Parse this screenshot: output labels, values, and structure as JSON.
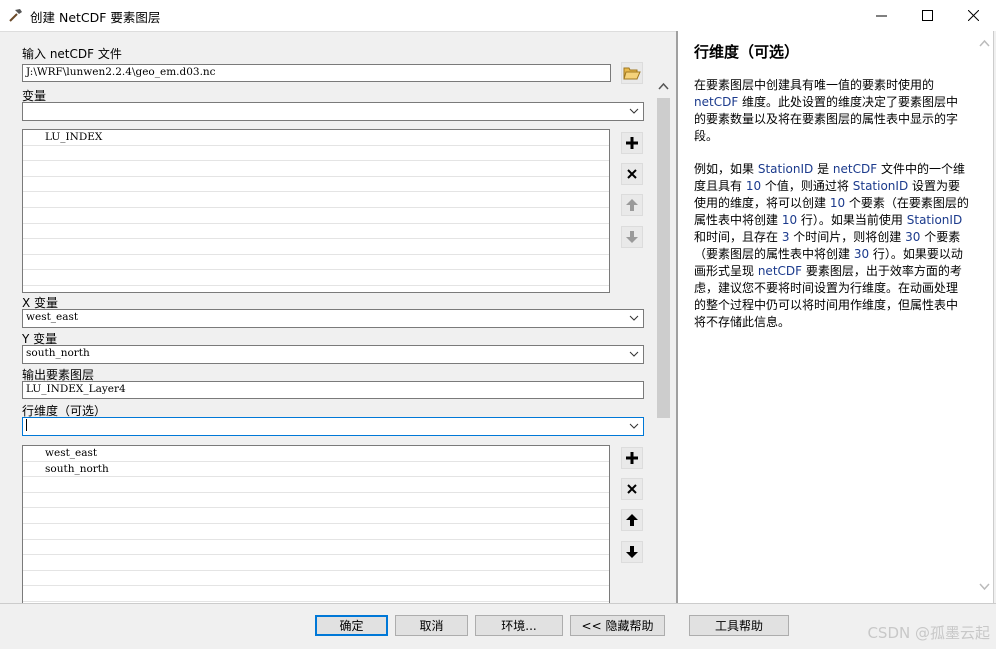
{
  "window": {
    "title": "创建 NetCDF 要素图层"
  },
  "form": {
    "input_file_label": "输入 netCDF 文件",
    "input_file_value": "J:\\WRF\\lunwen2.2.4\\geo_em.d03.nc",
    "variable_label": "变量",
    "variable_value": "",
    "variables_list": [
      "LU_INDEX"
    ],
    "x_label": "X 变量",
    "x_value": "west_east",
    "y_label": "Y 变量",
    "y_value": "south_north",
    "output_label": "输出要素图层",
    "output_value": "LU_INDEX_Layer4",
    "row_dim_label": "行维度（可选）",
    "row_dim_value": "",
    "row_dim_list": [
      "west_east",
      "south_north"
    ]
  },
  "help": {
    "title": "行维度（可选）",
    "para1": [
      {
        "t": "在要素图层中创建具有唯一值的要素时使用的 "
      },
      {
        "t": "netCDF",
        "hl": true
      },
      {
        "t": " 维度。此处设置的维度决定了要素图层中的要素数量以及将在要素图层的属性表中显示的字段。"
      }
    ],
    "para2": [
      {
        "t": "例如，如果 "
      },
      {
        "t": "StationID",
        "hl": true
      },
      {
        "t": " 是 "
      },
      {
        "t": "netCDF",
        "hl": true
      },
      {
        "t": " 文件中的一个维度且具有 "
      },
      {
        "t": "10",
        "hl": true
      },
      {
        "t": " 个值，则通过将 "
      },
      {
        "t": "StationID",
        "hl": true
      },
      {
        "t": " 设置为要使用的维度，将可以创建 "
      },
      {
        "t": "10",
        "hl": true
      },
      {
        "t": " 个要素（在要素图层的属性表中将创建 "
      },
      {
        "t": "10",
        "hl": true
      },
      {
        "t": " 行）。如果当前使用 "
      },
      {
        "t": "StationID",
        "hl": true
      },
      {
        "t": " 和时间，且存在 "
      },
      {
        "t": "3",
        "hl": true
      },
      {
        "t": " 个时间片，则将创建 "
      },
      {
        "t": "30",
        "hl": true
      },
      {
        "t": " 个要素（要素图层的属性表中将创建 "
      },
      {
        "t": "30",
        "hl": true
      },
      {
        "t": " 行）。如果要以动画形式呈现 "
      },
      {
        "t": "netCDF",
        "hl": true
      },
      {
        "t": " 要素图层，出于效率方面的考虑，建议您不要将时间设置为行维度。在动画处理的整个过程中仍可以将时间用作维度，但属性表中将不存储此信息。"
      }
    ]
  },
  "buttons": {
    "ok": "确定",
    "cancel": "取消",
    "env": "环境...",
    "hide_help": "<< 隐藏帮助",
    "tool_help": "工具帮助"
  },
  "watermark": "CSDN @孤墨云起",
  "icons": {
    "title": "hammer-icon",
    "folder": "open-folder-icon",
    "add": "plus-icon",
    "remove": "x-icon",
    "up": "arrow-up-icon",
    "down": "arrow-down-icon",
    "accent": "#0078d7"
  }
}
